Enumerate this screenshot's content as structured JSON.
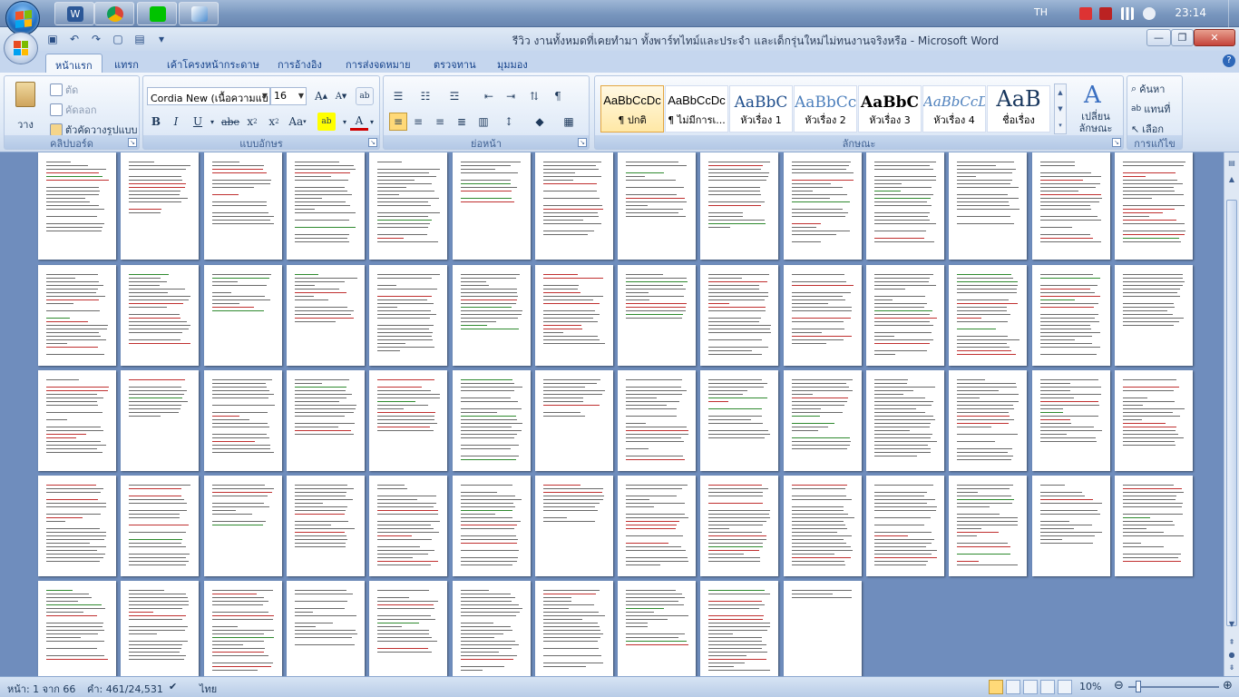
{
  "taskbar": {
    "apps": [
      {
        "name": "word-taskbar-button",
        "icon": "word-icon",
        "color": "#2b5797"
      },
      {
        "name": "chrome-taskbar-button",
        "icon": "chrome-icon",
        "color": "#dd4b39"
      },
      {
        "name": "line-taskbar-button",
        "icon": "chat-icon",
        "color": "#00c300"
      },
      {
        "name": "paint-taskbar-button",
        "icon": "paint-icon",
        "color": "#4c8ccf"
      }
    ],
    "language": "TH",
    "clock": "23:14"
  },
  "window": {
    "title": "รีวิว งานทั้งหมดที่เคยทำมา ทั้งพาร์ทไทม์และประจำ และเด็กรุ่นใหม่ไม่ทนงานจริงหรือ - Microsoft Word"
  },
  "tabs": [
    "หน้าแรก",
    "แทรก",
    "เค้าโครงหน้ากระดาษ",
    "การอ้างอิง",
    "การส่งจดหมาย",
    "ตรวจทาน",
    "มุมมอง"
  ],
  "ribbon": {
    "clipboard": {
      "label": "คลิปบอร์ด",
      "paste": "วาง",
      "cut": "ตัด",
      "copy": "คัดลอก",
      "format_painter": "ตัวคัดวางรูปแบบ"
    },
    "font": {
      "label": "แบบอักษร",
      "font_name": "Cordia New (เนื้อความแบ",
      "font_size": "16"
    },
    "paragraph": {
      "label": "ย่อหน้า"
    },
    "styles": {
      "label": "ลักษณะ",
      "items": [
        {
          "sample": "AaBbCcDc",
          "name": "¶ ปกติ"
        },
        {
          "sample": "AaBbCcDc",
          "name": "¶ ไม่มีการเ..."
        },
        {
          "sample": "AaBbC",
          "name": "หัวเรื่อง 1"
        },
        {
          "sample": "AaBbCc",
          "name": "หัวเรื่อง 2"
        },
        {
          "sample": "AaBbC",
          "name": "หัวเรื่อง 3"
        },
        {
          "sample": "AaBbCcD",
          "name": "หัวเรื่อง 4"
        },
        {
          "sample": "AaB",
          "name": "ชื่อเรื่อง"
        }
      ],
      "change_styles": "เปลี่ยน ลักษณะ"
    },
    "editing": {
      "label": "การแก้ไข",
      "find": "ค้นหา",
      "replace": "แทนที่",
      "select": "เลือก"
    }
  },
  "statusbar": {
    "page": "หน้า: 1 จาก 66",
    "words": "คำ: 461/24,531",
    "language": "ไทย",
    "zoom": "10%"
  },
  "document": {
    "page_count": 66,
    "pages_per_row": 14
  }
}
